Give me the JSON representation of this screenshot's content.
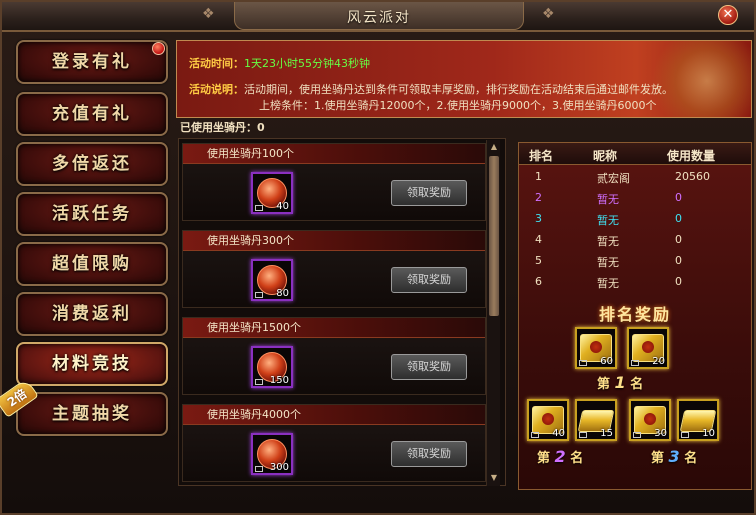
{
  "window": {
    "title": "风云派对"
  },
  "menu": {
    "items": [
      {
        "label": "登录有礼"
      },
      {
        "label": "充值有礼"
      },
      {
        "label": "多倍返还"
      },
      {
        "label": "活跃任务"
      },
      {
        "label": "超值限购"
      },
      {
        "label": "消费返利"
      },
      {
        "label": "材料竞技"
      },
      {
        "label": "主题抽奖"
      }
    ],
    "badge_x2": "2倍"
  },
  "activity": {
    "time_label": "活动时间：",
    "time_value": "1天23小时55分钟43秒钟",
    "desc_label": "活动说明：",
    "desc_text": "活动期间，使用坐骑丹达到条件可领取丰厚奖励，排行奖励在活动结束后通过邮件发放。",
    "rank_condition": "上榜条件：1.使用坐骑丹12000个，2.使用坐骑丹9000个，3.使用坐骑丹6000个",
    "used_label": "已使用坐骑丹：",
    "used_value": "0"
  },
  "rewards": [
    {
      "title": "使用坐骑丹100个",
      "count": "40",
      "button": "领取奖励"
    },
    {
      "title": "使用坐骑丹300个",
      "count": "80",
      "button": "领取奖励"
    },
    {
      "title": "使用坐骑丹1500个",
      "count": "150",
      "button": "领取奖励"
    },
    {
      "title": "使用坐骑丹4000个",
      "count": "300",
      "button": "领取奖励"
    }
  ],
  "ranking": {
    "headers": {
      "rank": "排名",
      "name": "昵称",
      "count": "使用数量"
    },
    "rows": [
      {
        "rank": "1",
        "name": "贰宏阁",
        "count": "20560",
        "color": "#f0e0c0"
      },
      {
        "rank": "2",
        "name": "暂无",
        "count": "0",
        "color": "#d070ff"
      },
      {
        "rank": "3",
        "name": "暂无",
        "count": "0",
        "color": "#40e0f0"
      },
      {
        "rank": "4",
        "name": "暂无",
        "count": "0",
        "color": "#f0e0c0"
      },
      {
        "rank": "5",
        "name": "暂无",
        "count": "0",
        "color": "#f0e0c0"
      },
      {
        "rank": "6",
        "name": "暂无",
        "count": "0",
        "color": "#f0e0c0"
      }
    ],
    "prize_title": "排名奖励",
    "first": {
      "pre": "第",
      "num": "1",
      "post": "名",
      "items": [
        "60",
        "20"
      ]
    },
    "second": {
      "pre": "第",
      "num": "2",
      "post": "名",
      "items": [
        "40",
        "15"
      ]
    },
    "third": {
      "pre": "第",
      "num": "3",
      "post": "名",
      "items": [
        "30",
        "10"
      ]
    }
  }
}
